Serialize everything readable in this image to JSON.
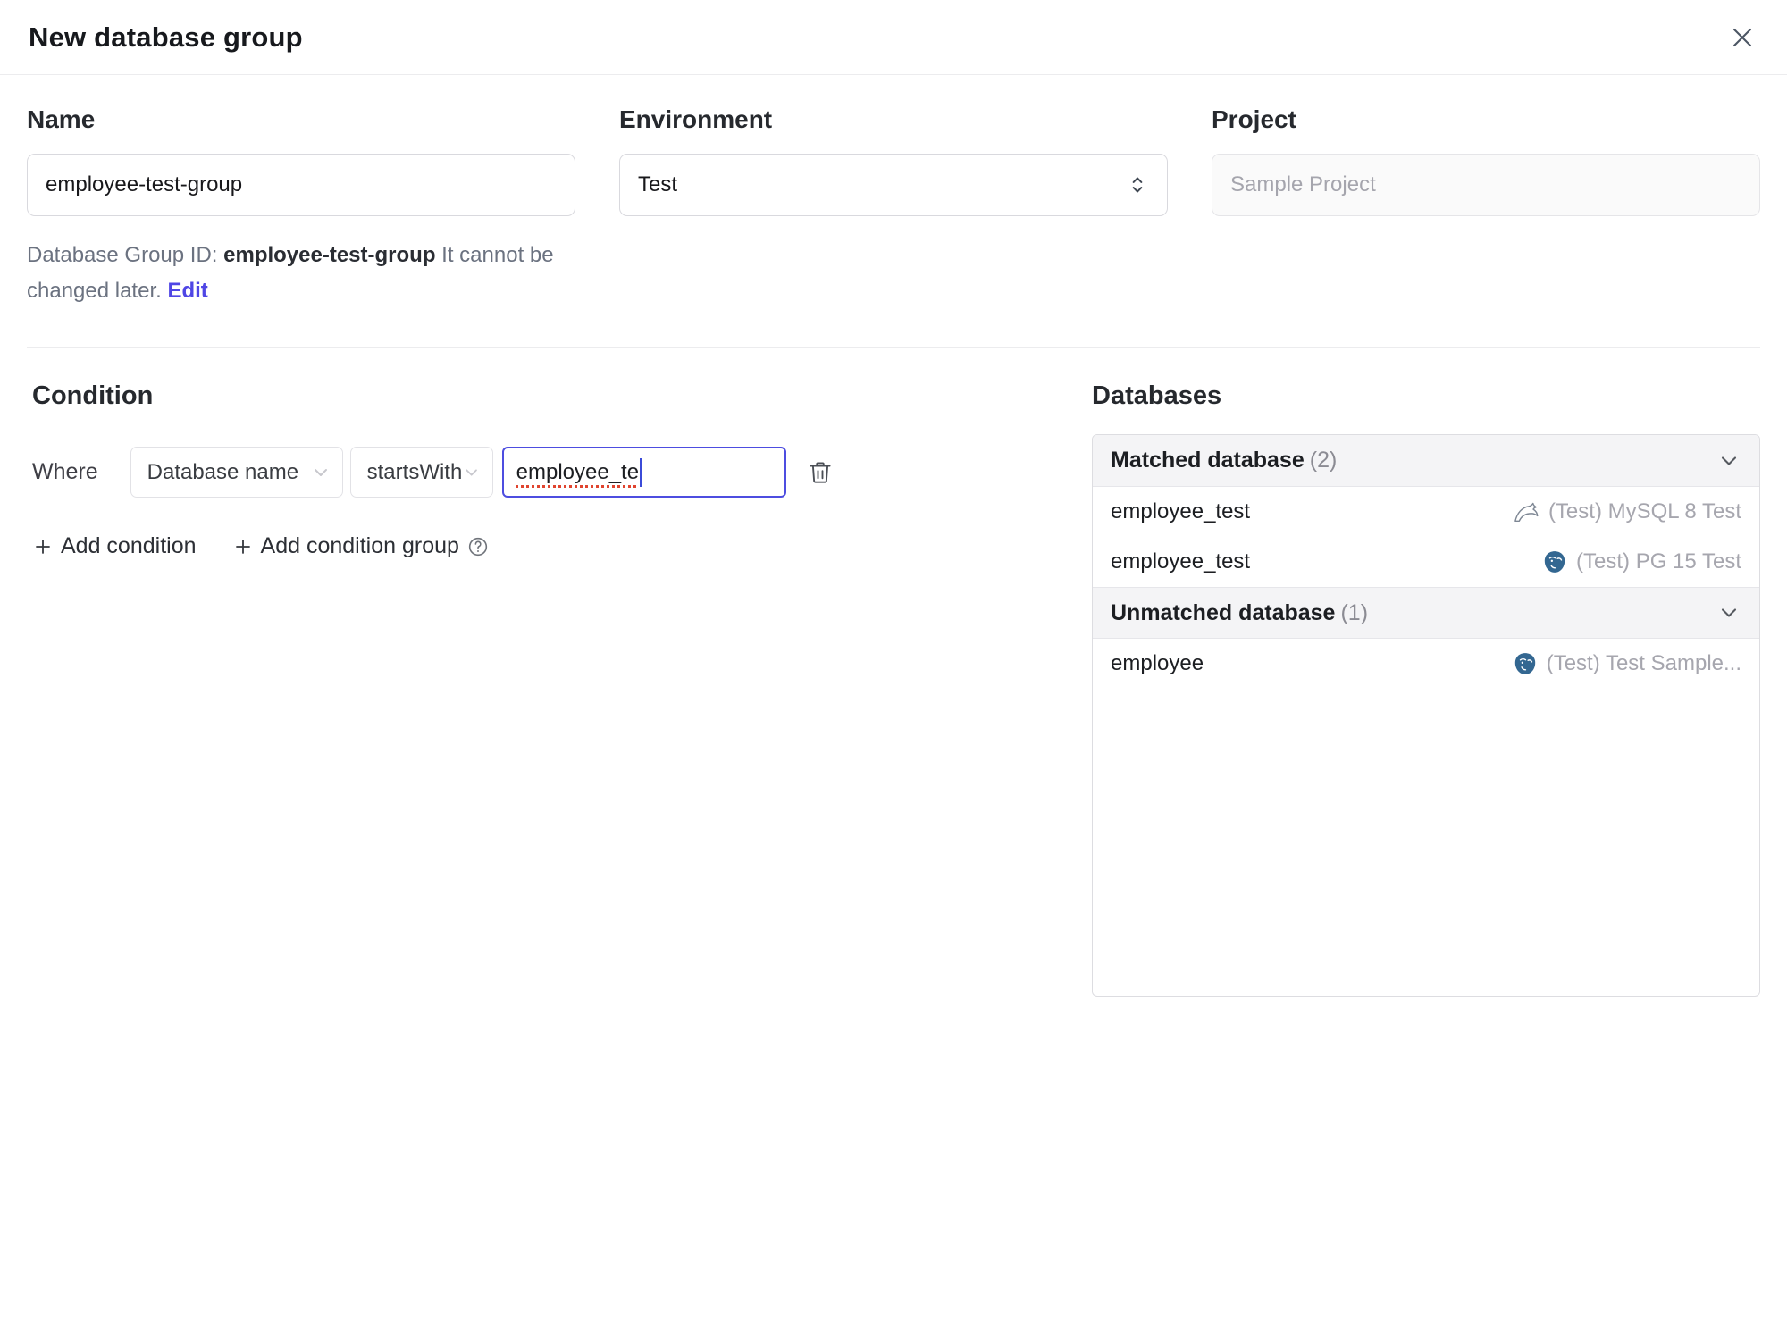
{
  "header": {
    "title": "New database group"
  },
  "form": {
    "name": {
      "label": "Name",
      "value": "employee-test-group"
    },
    "environment": {
      "label": "Environment",
      "value": "Test"
    },
    "project": {
      "label": "Project",
      "value": "Sample Project"
    },
    "id_hint": {
      "prefix": "Database Group ID: ",
      "id": "employee-test-group",
      "suffix": " It cannot be changed later. ",
      "edit_label": "Edit"
    }
  },
  "condition": {
    "title": "Condition",
    "where_label": "Where",
    "field_select": "Database name",
    "operator_select": "startsWith",
    "value_input": "employee_te",
    "add_condition_label": "Add condition",
    "add_condition_group_label": "Add condition group",
    "icons": [
      "chevron-down-icon",
      "trash-icon",
      "plus-icon",
      "help-circle-icon"
    ]
  },
  "databases": {
    "title": "Databases",
    "groups": [
      {
        "label": "Matched database",
        "count": "(2)",
        "rows": [
          {
            "name": "employee_test",
            "icon": "mysql-icon",
            "instance": "(Test) MySQL 8 Test"
          },
          {
            "name": "employee_test",
            "icon": "postgres-icon",
            "instance": "(Test) PG 15 Test"
          }
        ]
      },
      {
        "label": "Unmatched database",
        "count": "(1)",
        "rows": [
          {
            "name": "employee",
            "icon": "postgres-icon",
            "instance": "(Test) Test Sample..."
          }
        ]
      }
    ]
  },
  "colors": {
    "accent": "#4f46e5",
    "focus_border": "#4d4de0",
    "spellcheck_red": "#e0442f",
    "postgres_blue": "#336791",
    "panel_header_bg": "#f4f4f6",
    "muted_text": "#a6a6ae"
  }
}
